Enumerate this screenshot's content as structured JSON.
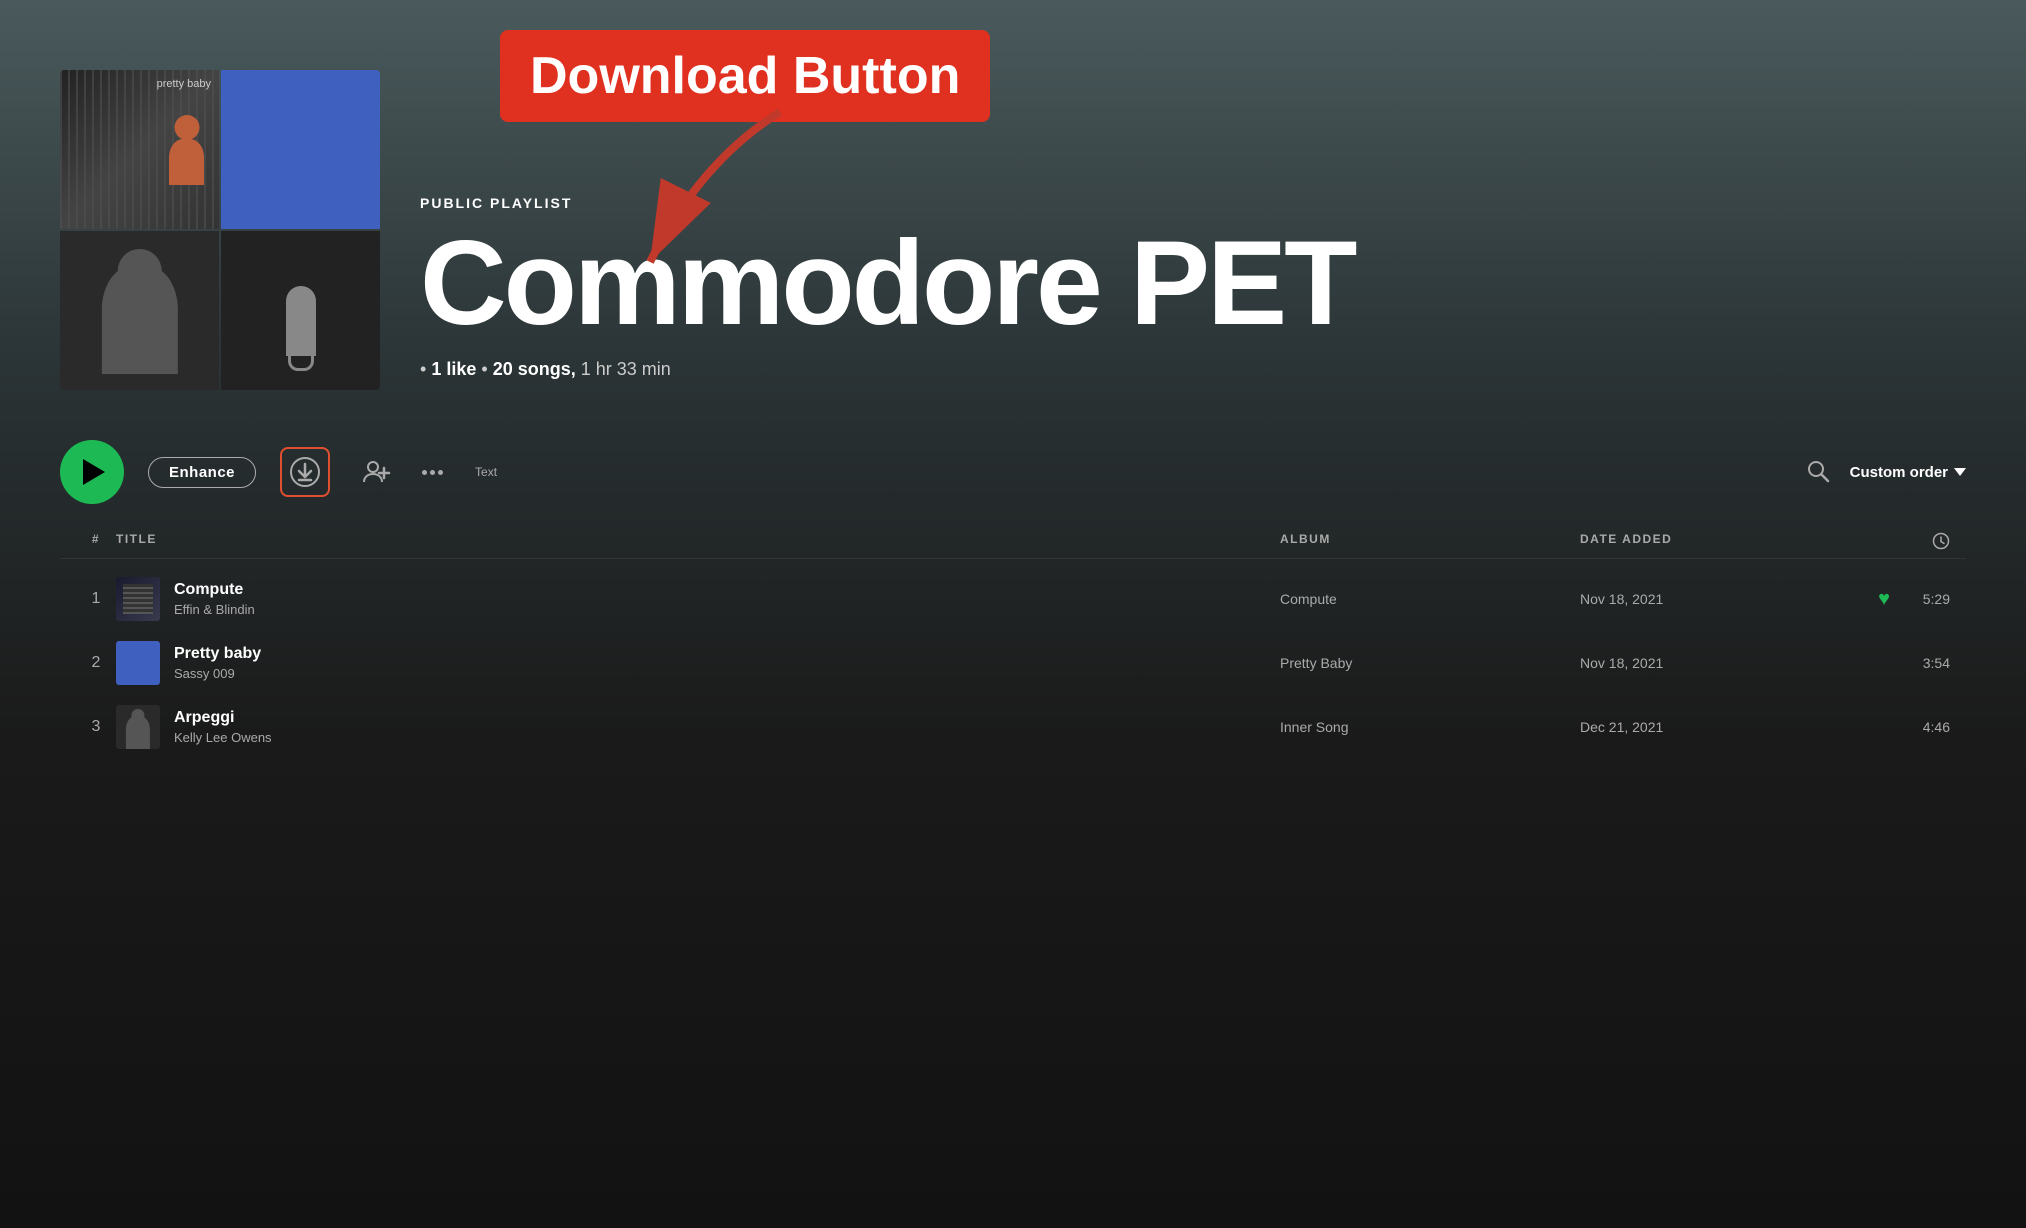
{
  "annotation": {
    "label": "Download Button",
    "arrow_direction": "down-left"
  },
  "hero": {
    "playlist_type": "PUBLIC PLAYLIST",
    "playlist_title": "Commodore PET",
    "meta": {
      "likes": "1 like",
      "songs": "20 songs,",
      "duration": "1 hr 33 min"
    }
  },
  "controls": {
    "enhance_label": "Enhance",
    "text_label": "Text",
    "custom_order_label": "Custom order"
  },
  "table": {
    "headers": {
      "num": "#",
      "title": "TITLE",
      "album": "ALBUM",
      "date_added": "DATE ADDED",
      "duration_icon": "clock"
    },
    "tracks": [
      {
        "num": "1",
        "name": "Compute",
        "artist": "Effin & Blindin",
        "album": "Compute",
        "date_added": "Nov 18, 2021",
        "liked": true,
        "duration": "5:29",
        "thumb_style": "striped"
      },
      {
        "num": "2",
        "name": "Pretty baby",
        "artist": "Sassy 009",
        "album": "Pretty Baby",
        "date_added": "Nov 18, 2021",
        "liked": false,
        "duration": "3:54",
        "thumb_style": "blue"
      },
      {
        "num": "3",
        "name": "Arpeggi",
        "artist": "Kelly Lee Owens",
        "album": "Inner Song",
        "date_added": "Dec 21, 2021",
        "liked": false,
        "duration": "4:46",
        "thumb_style": "person"
      }
    ]
  }
}
